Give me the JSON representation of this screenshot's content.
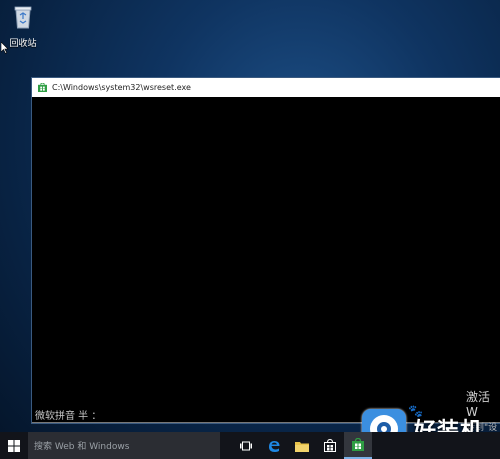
{
  "desktop": {
    "recycle_bin_label": "回收站"
  },
  "window": {
    "title": "C:\\Windows\\system32\\wsreset.exe",
    "ime_status": "微软拼音 半 ："
  },
  "activation": {
    "line1": "激活 W",
    "line2": "转到\"设置"
  },
  "watermark": {
    "text": "好装机"
  },
  "taskbar": {
    "search_placeholder": "搜索 Web 和 Windows"
  },
  "colors": {
    "accent": "#7bb1e8",
    "store_green": "#2f9e44",
    "edge_blue": "#1e88e5",
    "folder_yellow": "#e8c34a"
  }
}
